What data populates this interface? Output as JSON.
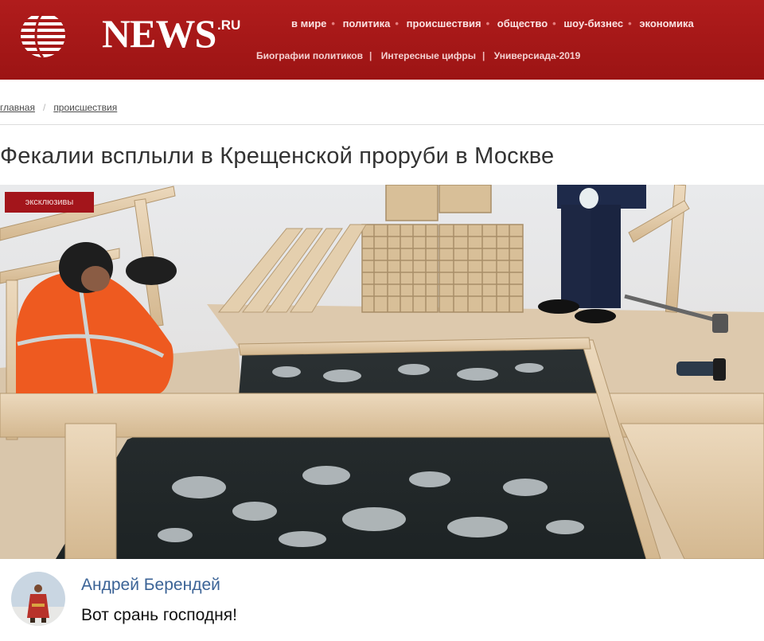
{
  "colors": {
    "header_bg": "#a51818",
    "badge_bg": "#a3151b",
    "author_link": "#3b6396",
    "worker_jacket": "#ef5a1f"
  },
  "header": {
    "logo_text": "NEWS",
    "logo_suffix": ".RU",
    "logo_icon": "striped-globe-icon",
    "nav_top": [
      "в мире",
      "политика",
      "происшествия",
      "общество",
      "шоу-бизнес",
      "экономика"
    ],
    "nav_sub": [
      "Биографии политиков",
      "Интересные цифры",
      "Универсиада-2019"
    ]
  },
  "breadcrumb": {
    "items": [
      "главная",
      "происшествия"
    ],
    "separator": "/"
  },
  "article": {
    "title": "Фекалии всплыли в Крещенской проруби в Москве",
    "badge": "эксклюзивы"
  },
  "comment": {
    "author": "Андрей Берендей",
    "text": "Вот срань господня!",
    "avatar_icon": "user-avatar"
  }
}
